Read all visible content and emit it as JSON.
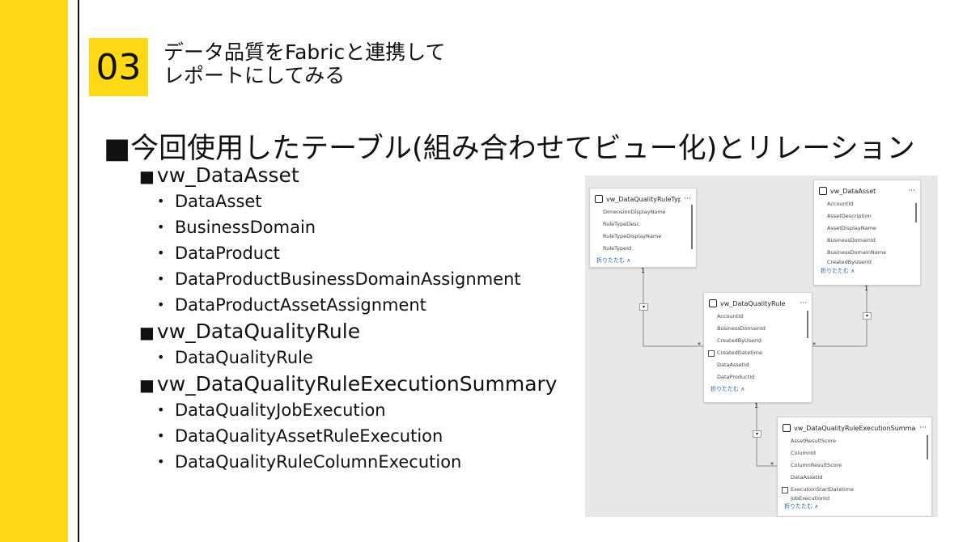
{
  "section": {
    "number": "03",
    "title_line1": "データ品質をFabricと連携して",
    "title_line2": "レポートにしてみる"
  },
  "heading": "■今回使用したテーブル(組み合わせてビュー化)とリレーション",
  "groups": [
    {
      "title": "vw_DataAsset",
      "items": [
        "DataAsset",
        "BusinessDomain",
        "DataProduct",
        "DataProductBusinessDomainAssignment",
        "DataProductAssetAssignment"
      ]
    },
    {
      "title": "vw_DataQualityRule",
      "items": [
        "DataQualityRule"
      ]
    },
    {
      "title": "vw_DataQualityRuleExecutionSummary",
      "items": [
        "DataQualityJobExecution",
        "DataQualityAssetRuleExecution",
        "DataQualityRuleColumnExecution"
      ]
    }
  ],
  "model": {
    "collapse_label": "折りたたむ ∧",
    "more_icon": "···",
    "cards": [
      {
        "title": "vw_DataQualityRuleType",
        "fields": [
          "DimensionDisplayName",
          "RuleTypeDesc",
          "RuleTypeDisplayName",
          "RuleTypeId"
        ]
      },
      {
        "title": "vw_DataAsset",
        "fields": [
          "AccountId",
          "AssetDescription",
          "AssetDisplayName",
          "BusinessDomainId",
          "BusinessDomainName",
          "CreatedByUserId"
        ]
      },
      {
        "title": "vw_DataQualityRule",
        "fields": [
          "AccountId",
          "BusinessDomainId",
          "CreatedByUserId",
          "CreatedDatetime",
          "DataAssetId",
          "DataProductId"
        ]
      },
      {
        "title": "vw_DataQualityRuleExecutionSummary",
        "fields": [
          "AssetResultScore",
          "ColumnId",
          "ColumnResultScore",
          "DataAssetId",
          "ExecutionStartDatetime",
          "JobExecutionId"
        ]
      }
    ],
    "relations": {
      "one": "1",
      "many": "*"
    }
  }
}
